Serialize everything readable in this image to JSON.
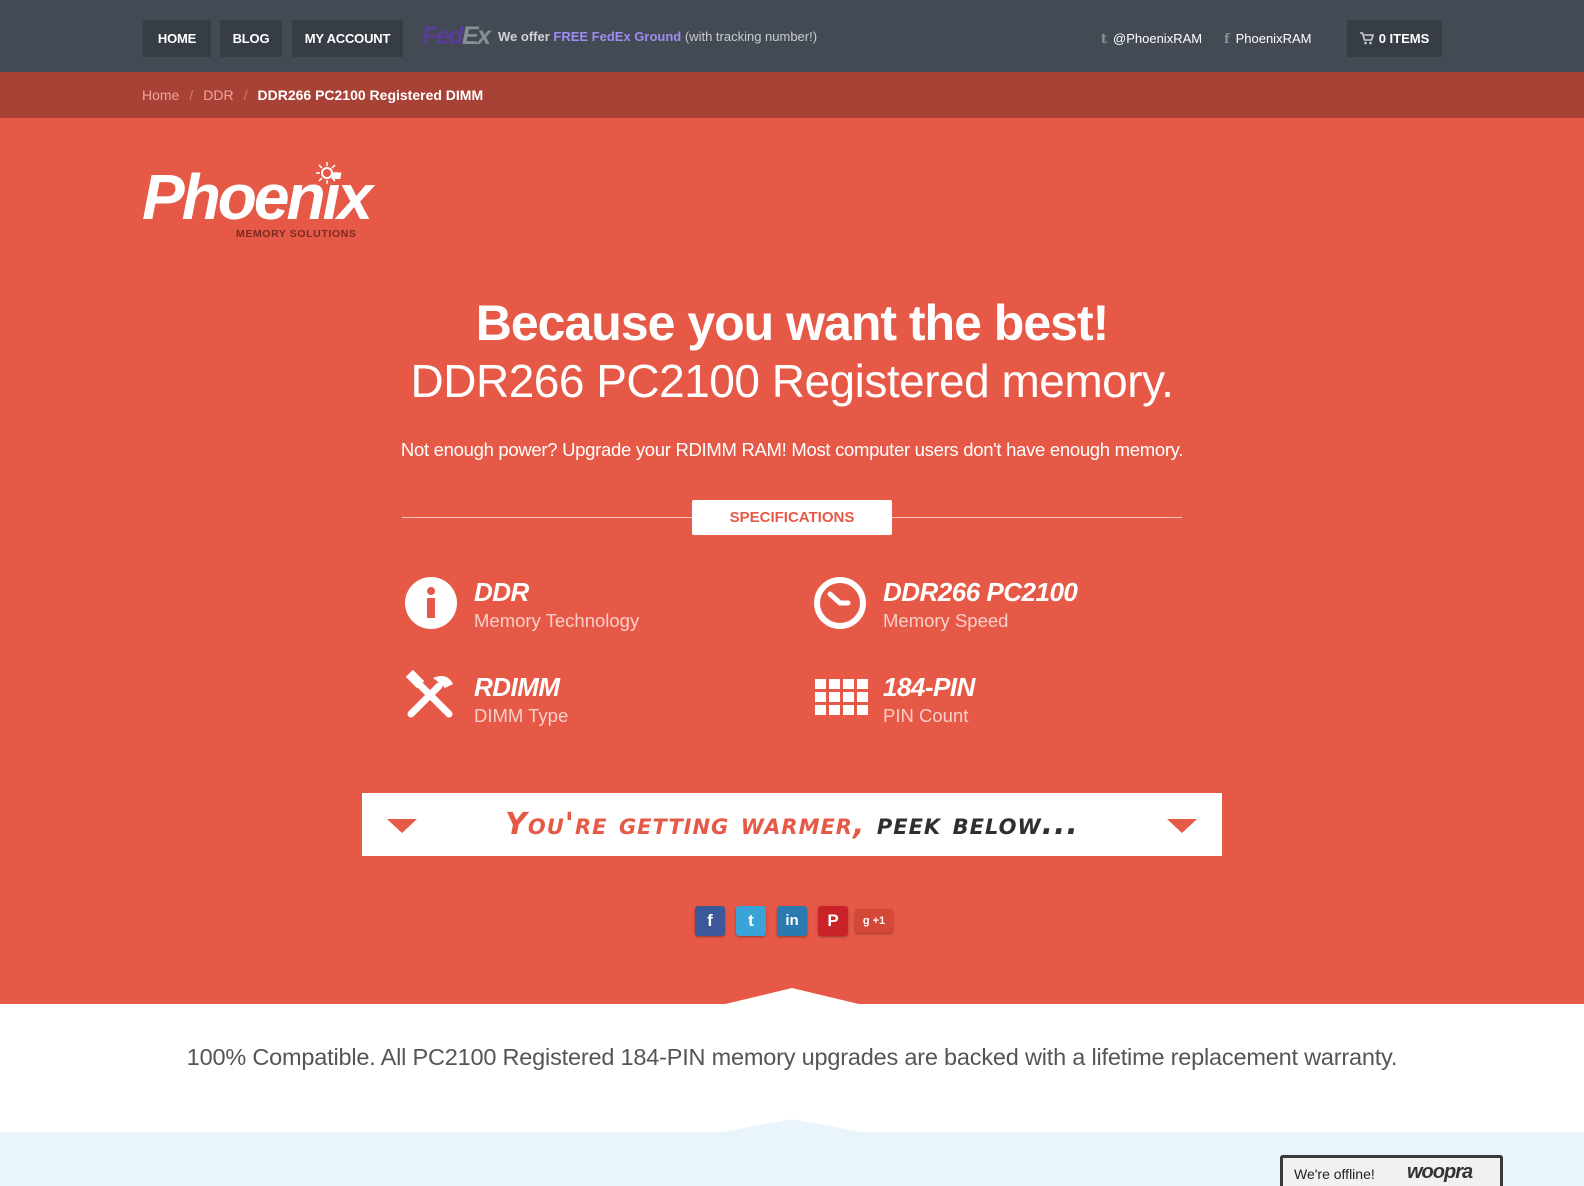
{
  "topbar": {
    "nav": [
      "HOME",
      "BLOG",
      "MY ACCOUNT"
    ],
    "fedex_fed": "Fed",
    "fedex_ex": "Ex",
    "offer_prefix": "We offer ",
    "offer_highlight": "FREE FedEx Ground",
    "offer_suffix": " (with tracking number!)",
    "twitter_handle": "@PhoenixRAM",
    "facebook_handle": "PhoenixRAM",
    "cart_label": "0 ITEMS"
  },
  "breadcrumb": {
    "items": [
      "Home",
      "DDR"
    ],
    "separator": "/",
    "current": "DDR266 PC2100 Registered DIMM"
  },
  "logo": {
    "word": "Phoenix",
    "sub": "MEMORY SOLUTIONS"
  },
  "hero": {
    "headline": "Because you want the best!",
    "subhead": "DDR266 PC2100 Registered memory.",
    "tagline": "Not enough power? Upgrade your RDIMM RAM! Most computer users don't have enough memory.",
    "spec_title": "SPECIFICATIONS",
    "specs": [
      {
        "value": "DDR",
        "label": "Memory Technology",
        "icon": "info-icon"
      },
      {
        "value": "DDR266 PC2100",
        "label": "Memory Speed",
        "icon": "clock-icon"
      },
      {
        "value": "RDIMM",
        "label": "DIMM Type",
        "icon": "tools-icon"
      },
      {
        "value": "184-PIN",
        "label": "PIN Count",
        "icon": "grid-icon"
      }
    ],
    "warm_a": "You're getting warmer, ",
    "warm_b": "peek below..."
  },
  "share": [
    {
      "name": "facebook",
      "glyph": "f",
      "color": "#3b5998"
    },
    {
      "name": "twitter",
      "glyph": "t",
      "color": "#3aa3d8"
    },
    {
      "name": "linkedin",
      "glyph": "in",
      "color": "#2a7ab0"
    },
    {
      "name": "pinterest",
      "glyph": "P",
      "color": "#c92228"
    },
    {
      "name": "google-plus",
      "glyph": "g +1",
      "color": "#d34836"
    }
  ],
  "warranty": "100% Compatible. All PC2100 Registered 184-PIN memory upgrades are backed with a lifetime replacement warranty.",
  "chat": {
    "status": "We're offline!",
    "brand": "woopra"
  },
  "colors": {
    "hero": "#e65947",
    "topbar": "#434a54",
    "breadcrumb_bar": "#a94236"
  }
}
